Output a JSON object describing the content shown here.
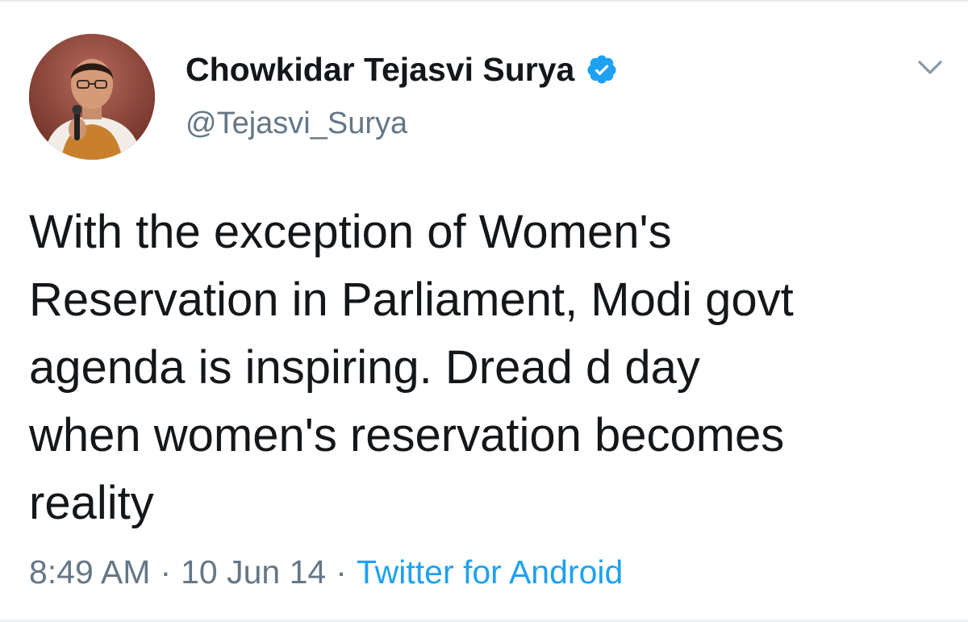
{
  "tweet": {
    "author": {
      "display_name": "Chowkidar Tejasvi Surya",
      "handle": "@Tejasvi_Surya",
      "verified": true
    },
    "text": "With the exception of Women's\nReservation in Parliament, Modi govt\nagenda is inspiring. Dread d day\nwhen women's reservation becomes\nreality",
    "time": "8:49 AM",
    "separator": "·",
    "date": "10 Jun 14",
    "source": "Twitter for Android"
  },
  "icons": {
    "verified": "verified-badge-icon",
    "menu": "chevron-down-icon"
  },
  "colors": {
    "accent": "#1da1f2",
    "text": "#14171a",
    "muted": "#657786"
  }
}
